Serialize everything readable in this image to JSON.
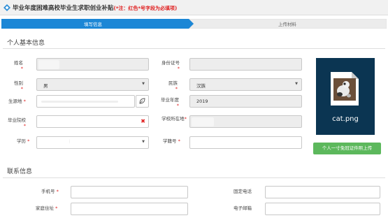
{
  "header": {
    "title": "毕业年度困难高校毕业生求职创业补贴",
    "note": "(*注：红色*号字段为必填项)"
  },
  "steps": [
    {
      "label": "填写信息",
      "active": true
    },
    {
      "label": "上传材料",
      "active": false
    }
  ],
  "personal": {
    "section_title": "个人基本信息",
    "name_label": "姓名",
    "id_label": "身份证号",
    "gender_label": "性别",
    "gender_value": "男",
    "ethnicity_label": "民族",
    "ethnicity_value": "汉族",
    "origin_label": "生源地",
    "grad_year_label": "毕业年度",
    "grad_year_value": "2019",
    "school_label": "毕业院校",
    "school_loc_label": "学校所在地",
    "degree_label": "学历",
    "student_no_label": "学籍号",
    "required_mark": "*"
  },
  "photo": {
    "file_name": "cat.png",
    "upload_button": "个人一寸免冠证件照上传"
  },
  "contact": {
    "section_title": "联系信息",
    "phone_label": "手机号",
    "landline_label": "固定电话",
    "address_label": "家庭住址",
    "email_label": "电子邮箱"
  },
  "colors": {
    "step_active": "#1c87d6",
    "step_inactive": "#ececec",
    "required": "#e02020",
    "upload_button": "#5cb85c",
    "photo_bg": "#0b3552"
  }
}
